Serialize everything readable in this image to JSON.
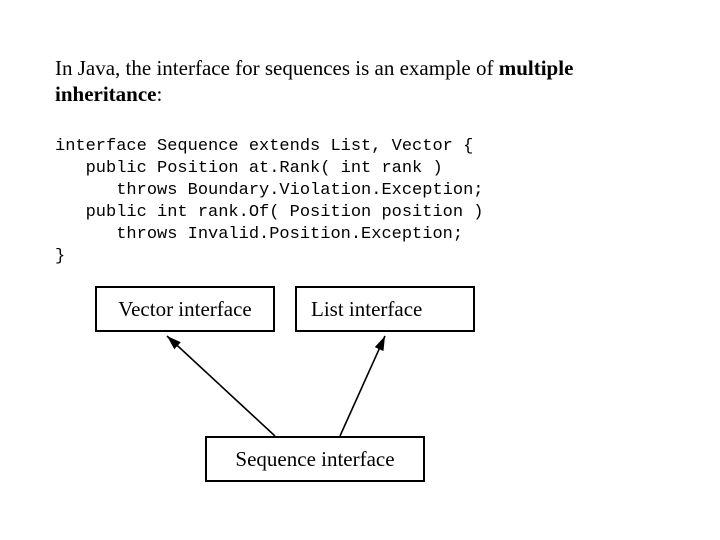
{
  "intro": {
    "prefix": "In Java, the interface for sequences is an example of  ",
    "bold": "multiple inheritance",
    "suffix": ":"
  },
  "code": {
    "l1": "interface Sequence extends List, Vector {",
    "l2": "   public Position at.Rank( int rank )",
    "l3": "      throws Boundary.Violation.Exception;",
    "l4": "   public int rank.Of( Position position )",
    "l5": "      throws Invalid.Position.Exception;",
    "l6": "}"
  },
  "diagram": {
    "vector_label": "Vector interface",
    "list_label": "List interface",
    "sequence_label": "Sequence interface"
  }
}
